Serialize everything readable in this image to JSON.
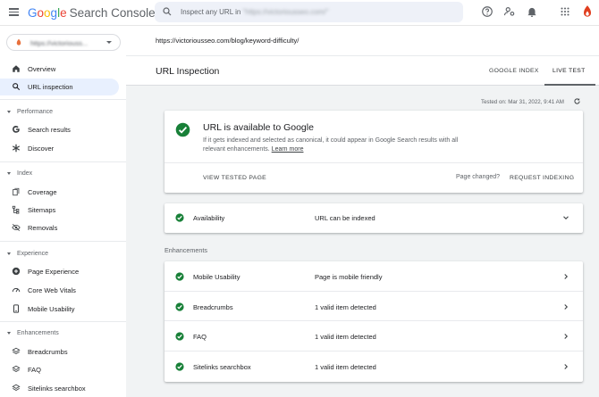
{
  "app": {
    "logo": {
      "letters": [
        "G",
        "o",
        "o",
        "g",
        "l",
        "e"
      ],
      "product": "Search Console"
    },
    "search": {
      "prefix": "Inspect any URL in",
      "property_hint": "\"https://victoriousseo.com/\""
    }
  },
  "sidebar": {
    "property": "https://victoriouss...",
    "items_top": [
      {
        "label": "Overview",
        "icon": "home-icon"
      },
      {
        "label": "URL inspection",
        "icon": "search-icon",
        "active": true
      }
    ],
    "sections": [
      {
        "title": "Performance",
        "items": [
          {
            "label": "Search results",
            "icon": "google-g-icon"
          },
          {
            "label": "Discover",
            "icon": "asterisk-icon"
          }
        ]
      },
      {
        "title": "Index",
        "items": [
          {
            "label": "Coverage",
            "icon": "file-copy-icon"
          },
          {
            "label": "Sitemaps",
            "icon": "sitemap-icon"
          },
          {
            "label": "Removals",
            "icon": "eye-off-icon"
          }
        ]
      },
      {
        "title": "Experience",
        "items": [
          {
            "label": "Page Experience",
            "icon": "plus-circle-icon"
          },
          {
            "label": "Core Web Vitals",
            "icon": "speedometer-icon"
          },
          {
            "label": "Mobile Usability",
            "icon": "smartphone-icon"
          }
        ]
      },
      {
        "title": "Enhancements",
        "items": [
          {
            "label": "Breadcrumbs",
            "icon": "layers-icon"
          },
          {
            "label": "FAQ",
            "icon": "layers-icon"
          },
          {
            "label": "Sitelinks searchbox",
            "icon": "layers-icon"
          }
        ]
      }
    ]
  },
  "main": {
    "url": "https://victoriousseo.com/blog/keyword-difficulty/",
    "title": "URL Inspection",
    "tabs": {
      "google_index": "GOOGLE INDEX",
      "live_test": "LIVE TEST",
      "active": "live_test"
    },
    "tested_on": "Tested on: Mar 31, 2022, 9:41 AM",
    "status": {
      "heading": "URL is available to Google",
      "description": "If it gets indexed and selected as canonical, it could appear in Google Search results with all relevant enhancements.",
      "learn_more": "Learn more",
      "view_tested_page": "VIEW TESTED PAGE",
      "page_changed": "Page changed?",
      "request_indexing": "REQUEST INDEXING"
    },
    "availability": {
      "name": "Availability",
      "value": "URL can be indexed"
    },
    "enhancements_label": "Enhancements",
    "enhancements": [
      {
        "name": "Mobile Usability",
        "value": "Page is mobile friendly"
      },
      {
        "name": "Breadcrumbs",
        "value": "1 valid item detected"
      },
      {
        "name": "FAQ",
        "value": "1 valid item detected"
      },
      {
        "name": "Sitelinks searchbox",
        "value": "1 valid item detected"
      }
    ]
  },
  "colors": {
    "check_green": "#188038",
    "active_bg": "#e8f0fe",
    "brand_blue": "#4285f4"
  }
}
